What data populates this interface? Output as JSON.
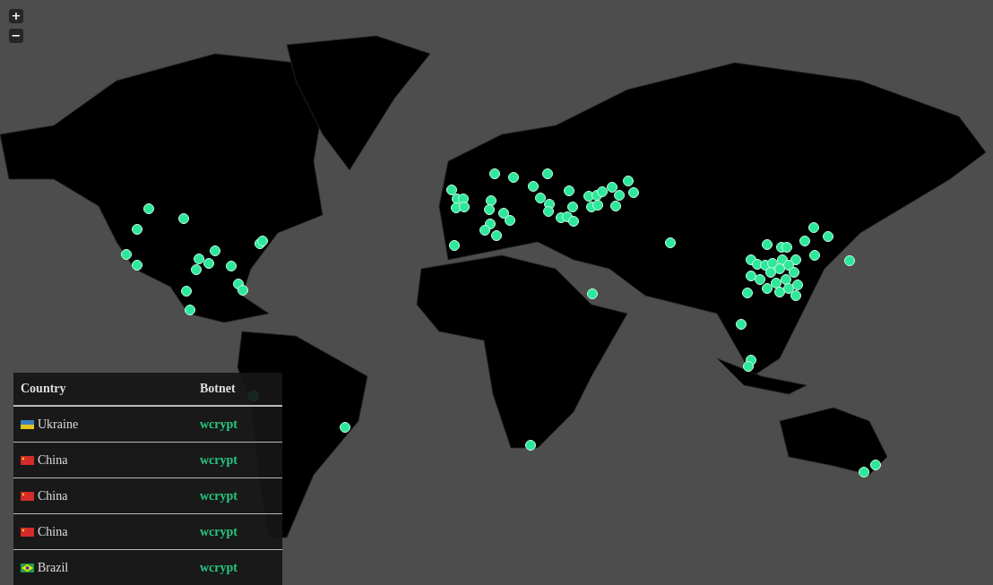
{
  "zoom_controls": [
    "+",
    "−"
  ],
  "table": {
    "columns": [
      "Country",
      "Botnet"
    ],
    "rows": [
      {
        "kind": "ukraine",
        "country": "Ukraine",
        "botnet": "wcrypt"
      },
      {
        "kind": "china",
        "country": "China",
        "botnet": "wcrypt"
      },
      {
        "kind": "china",
        "country": "China",
        "botnet": "wcrypt"
      },
      {
        "kind": "china",
        "country": "China",
        "botnet": "wcrypt"
      },
      {
        "kind": "brazil",
        "country": "Brazil",
        "botnet": "wcrypt"
      }
    ]
  }
}
